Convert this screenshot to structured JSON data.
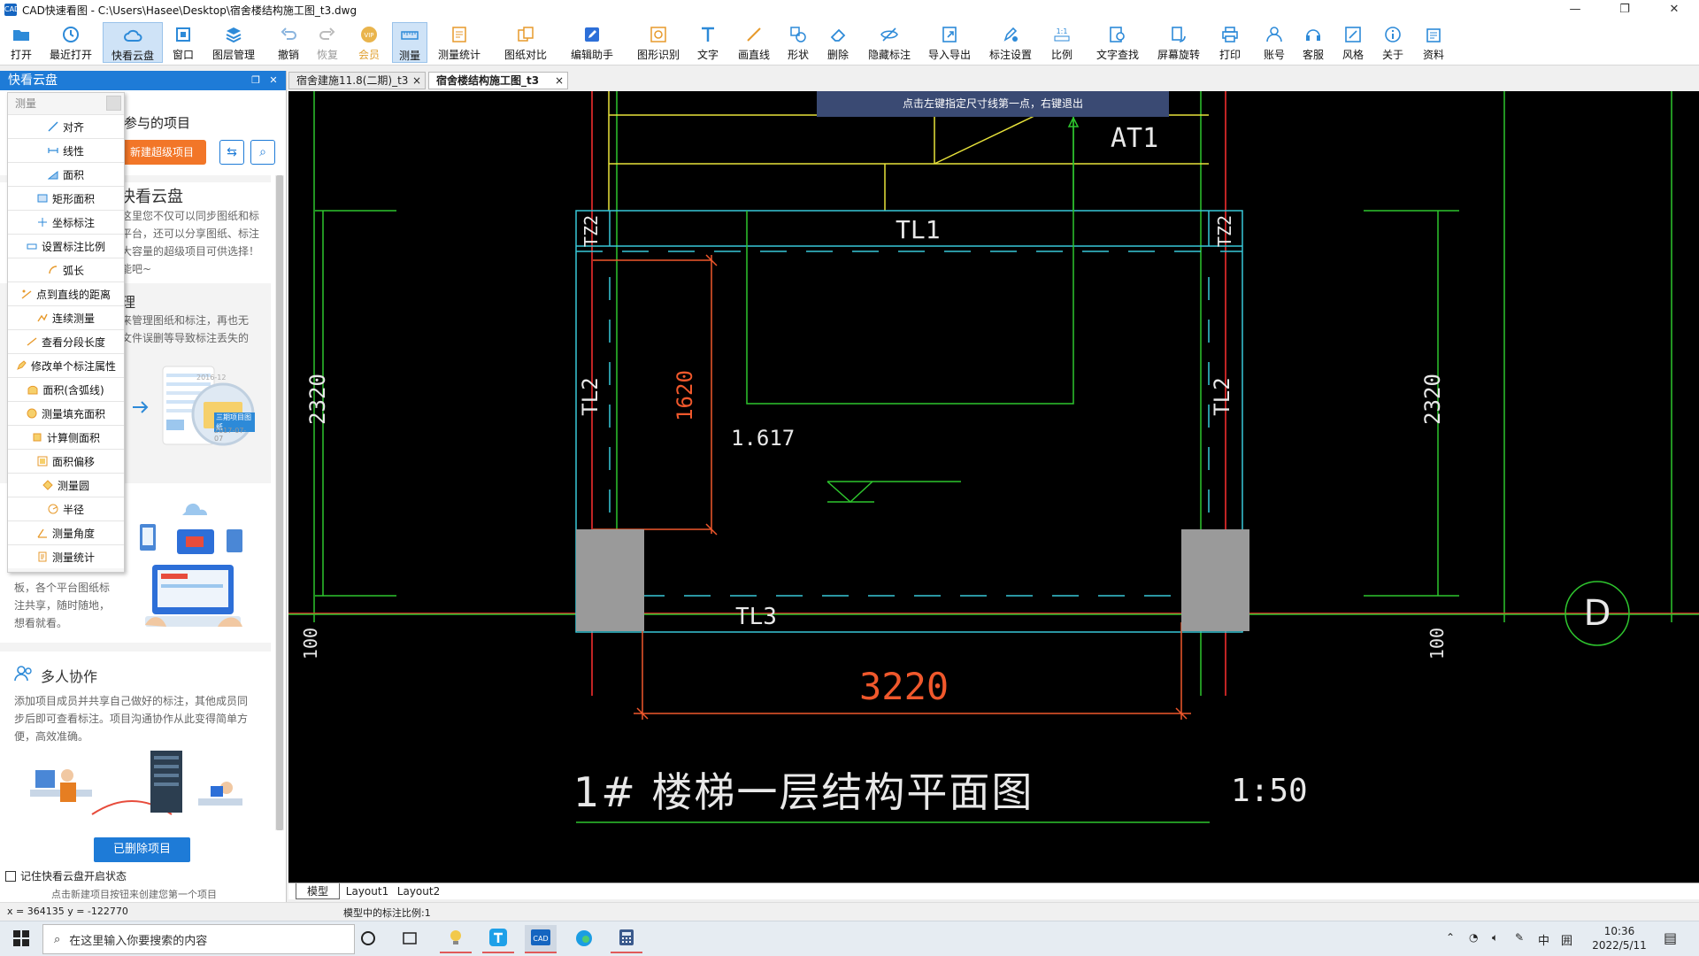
{
  "window": {
    "title": "CAD快速看图 - C:\\Users\\Hasee\\Desktop\\宿舍楼结构施工图_t3.dwg",
    "app_icon": "cad-app-icon"
  },
  "toolbar": {
    "open": "打开",
    "recent": "最近打开",
    "cloud": "快看云盘",
    "window": "窗口",
    "layers": "图层管理",
    "undo": "撤销",
    "redo": "恢复",
    "vip": "会员",
    "measure": "测量",
    "measure_stats": "测量统计",
    "compare": "图纸对比",
    "edit_helper": "编辑助手",
    "shape_recog": "图形识别",
    "text": "文字",
    "line": "画直线",
    "shape": "形状",
    "delete": "删除",
    "hide_marks": "隐藏标注",
    "import_export": "导入导出",
    "mark_settings": "标注设置",
    "scale": "比例",
    "text_find": "文字查找",
    "rotate": "屏幕旋转",
    "print": "打印",
    "account": "账号",
    "service": "客服",
    "style": "风格",
    "about": "关于",
    "resources": "资料"
  },
  "left_panel": {
    "header": "快看云盘",
    "project_title": "参与的项目",
    "new_super_project": "新建超级项目",
    "intro_title": "快看云盘",
    "intro_text": [
      "这里您不仅可以同步图纸和标",
      "平台，还可以分享图纸、标注",
      "大容量的超级项目可供选择！",
      "能吧~"
    ],
    "manage_title": "理",
    "manage_text": [
      "来管理图纸和标注，再也无",
      "文件误删等导致标注丢失的"
    ],
    "illus_label_1": "三期项目图纸",
    "illus_date_1": "2016-12",
    "illus_date_2": "2017-07-07",
    "share_text": [
      "板，各个平台图纸标",
      "注共享，随时随地，",
      "想看就看。"
    ],
    "collab_title": "多人协作",
    "collab_text": [
      "添加项目成员并共享自己做好的标注，其他成员同",
      "步后即可查看标注。项目沟通协作从此变得简单方",
      "便，高效准确。"
    ],
    "deleted_button": "已删除项目",
    "remember_label": "记住快看云盘开启状态",
    "hint": "点击新建项目按钮来创建您第一个项目"
  },
  "measure_menu": {
    "header": "测量",
    "items": [
      "对齐",
      "线性",
      "面积",
      "矩形面积",
      "坐标标注",
      "设置标注比例",
      "弧长",
      "点到直线的距离",
      "连续测量",
      "查看分段长度",
      "修改单个标注属性",
      "面积(含弧线)",
      "测量填充面积",
      "计算侧面积",
      "面积偏移",
      "测量圆",
      "半径",
      "测量角度",
      "测量统计"
    ]
  },
  "tabs": {
    "tab1": "宿舍建施11.8(二期)_t3",
    "tab2": "宿舍楼结构施工图_t3",
    "close": "×"
  },
  "drawing": {
    "tooltip": "点击左键指定尺寸线第一点，右键退出",
    "at1": "AT1",
    "tl1": "TL1",
    "tz2_left": "TZ2",
    "tz2_right": "TZ2",
    "tl2_left": "TL2",
    "tl2_right": "TL2",
    "tl3": "TL3",
    "dim_1620": "1620",
    "dim_2320_left": "2320",
    "dim_2320_right": "2320",
    "dim_100_left": "100",
    "dim_100_right": "100",
    "dim_3220": "3220",
    "level": "1.617",
    "axis_d": "D",
    "title": "1# 楼梯一层结构平面图",
    "scale": "1:50",
    "colors": {
      "red": "#ff3030",
      "green": "#2ec52e",
      "cyan": "#38c7d8",
      "yellow": "#e7e23a",
      "orange": "#f0582c",
      "white": "#e8e8e8",
      "gray": "#9a9a9a",
      "tooltip_bg": "#3a4a73"
    }
  },
  "layout_tabs": {
    "model": "模型",
    "layout1": "Layout1",
    "layout2": "Layout2"
  },
  "status": {
    "coords": "x = 364135  y = -122770",
    "scale": "模型中的标注比例:1"
  },
  "taskbar": {
    "search_placeholder": "在这里输入你要搜索的内容",
    "time": "10:36",
    "date": "2022/5/11",
    "ime": "中",
    "ime2": "囲"
  }
}
